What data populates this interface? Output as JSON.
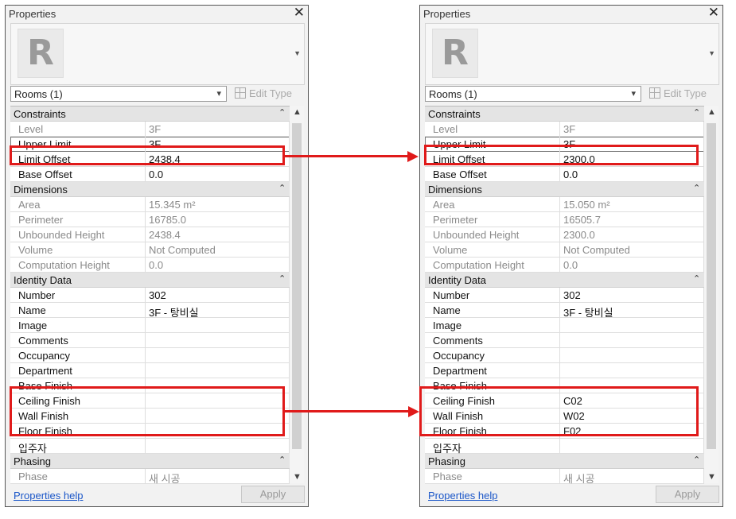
{
  "panel_title": "Properties",
  "close_symbol": "✕",
  "type_selector": "Rooms (1)",
  "edit_type_label": "Edit Type",
  "properties_help": "Properties help",
  "apply_label": "Apply",
  "collapse_symbol": "⌃",
  "icons": [
    "revit-logo-icon",
    "close-icon",
    "chevron-down-icon",
    "edit-type-icon",
    "collapse-icon",
    "scroll-up-icon",
    "scroll-down-icon",
    "arrow-right-icon"
  ],
  "colors": {
    "highlight": "#e01a1a",
    "link": "#1a56c8"
  },
  "left": {
    "groups": {
      "constraints": "Constraints",
      "dimensions": "Dimensions",
      "identity": "Identity Data",
      "phasing": "Phasing"
    },
    "rows": {
      "level": {
        "label": "Level",
        "value": "3F"
      },
      "upper_limit": {
        "label": "Upper Limit",
        "value": "3F"
      },
      "limit_offset": {
        "label": "Limit Offset",
        "value": "2438.4"
      },
      "base_offset": {
        "label": "Base Offset",
        "value": "0.0"
      },
      "area": {
        "label": "Area",
        "value": "15.345 m²"
      },
      "perimeter": {
        "label": "Perimeter",
        "value": "16785.0"
      },
      "unbounded_height": {
        "label": "Unbounded Height",
        "value": "2438.4"
      },
      "volume": {
        "label": "Volume",
        "value": "Not Computed"
      },
      "computation_height": {
        "label": "Computation Height",
        "value": "0.0"
      },
      "number": {
        "label": "Number",
        "value": "302"
      },
      "name": {
        "label": "Name",
        "value": "3F - 탕비실"
      },
      "image": {
        "label": "Image",
        "value": ""
      },
      "comments": {
        "label": "Comments",
        "value": ""
      },
      "occupancy": {
        "label": "Occupancy",
        "value": ""
      },
      "department": {
        "label": "Department",
        "value": ""
      },
      "base_finish": {
        "label": "Base Finish",
        "value": ""
      },
      "ceiling_finish": {
        "label": "Ceiling Finish",
        "value": ""
      },
      "wall_finish": {
        "label": "Wall Finish",
        "value": ""
      },
      "floor_finish": {
        "label": "Floor Finish",
        "value": ""
      },
      "occupant": {
        "label": "입주자",
        "value": ""
      },
      "phase": {
        "label": "Phase",
        "value": "새 시공"
      }
    }
  },
  "right": {
    "groups": {
      "constraints": "Constraints",
      "dimensions": "Dimensions",
      "identity": "Identity Data",
      "phasing": "Phasing"
    },
    "rows": {
      "level": {
        "label": "Level",
        "value": "3F"
      },
      "upper_limit": {
        "label": "Upper Limit",
        "value": "3F"
      },
      "limit_offset": {
        "label": "Limit Offset",
        "value": "2300.0"
      },
      "base_offset": {
        "label": "Base Offset",
        "value": "0.0"
      },
      "area": {
        "label": "Area",
        "value": "15.050 m²"
      },
      "perimeter": {
        "label": "Perimeter",
        "value": "16505.7"
      },
      "unbounded_height": {
        "label": "Unbounded Height",
        "value": "2300.0"
      },
      "volume": {
        "label": "Volume",
        "value": "Not Computed"
      },
      "computation_height": {
        "label": "Computation Height",
        "value": "0.0"
      },
      "number": {
        "label": "Number",
        "value": "302"
      },
      "name": {
        "label": "Name",
        "value": "3F - 탕비실"
      },
      "image": {
        "label": "Image",
        "value": ""
      },
      "comments": {
        "label": "Comments",
        "value": ""
      },
      "occupancy": {
        "label": "Occupancy",
        "value": ""
      },
      "department": {
        "label": "Department",
        "value": ""
      },
      "base_finish": {
        "label": "Base Finish",
        "value": ""
      },
      "ceiling_finish": {
        "label": "Ceiling Finish",
        "value": "C02"
      },
      "wall_finish": {
        "label": "Wall Finish",
        "value": "W02"
      },
      "floor_finish": {
        "label": "Floor Finish",
        "value": "F02"
      },
      "occupant": {
        "label": "입주자",
        "value": ""
      },
      "phase": {
        "label": "Phase",
        "value": "새 시공"
      }
    }
  }
}
